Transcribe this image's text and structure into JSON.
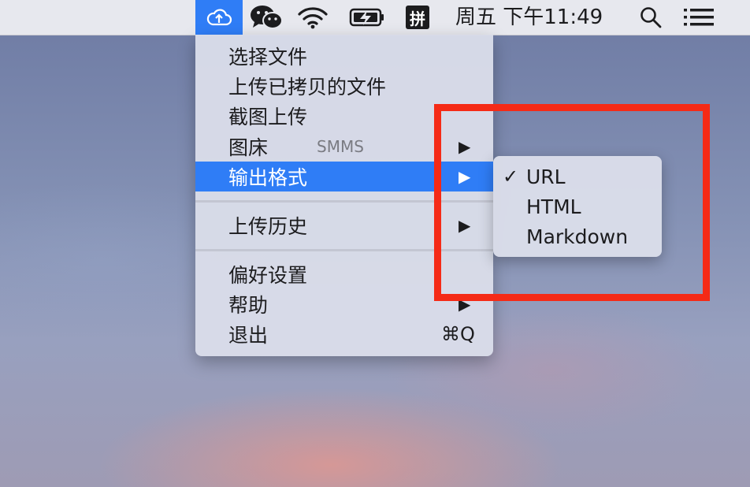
{
  "menubar": {
    "clock": "周五 下午11:49",
    "ime_label": "拼",
    "icons": [
      "cloud-upload-icon",
      "wechat-icon",
      "wifi-icon",
      "battery-charging-icon",
      "pinyin-input-icon",
      "search-icon",
      "list-icon"
    ],
    "accent": "#2f7df6"
  },
  "menu": {
    "items": [
      {
        "label": "选择文件"
      },
      {
        "label": "上传已拷贝的文件"
      },
      {
        "label": "截图上传"
      },
      {
        "label": "图床",
        "sub": "SMMS",
        "arrow": "▶"
      },
      {
        "label": "输出格式",
        "arrow": "▶"
      },
      {
        "label": "上传历史",
        "arrow": "▶"
      },
      {
        "label": "偏好设置"
      },
      {
        "label": "帮助",
        "arrow": "▶"
      },
      {
        "label": "退出",
        "shortcut": "⌘Q"
      }
    ]
  },
  "submenu": {
    "items": [
      {
        "label": "URL",
        "check": "✓"
      },
      {
        "label": "HTML"
      },
      {
        "label": "Markdown"
      }
    ]
  },
  "annotation_color": "#f52a16"
}
